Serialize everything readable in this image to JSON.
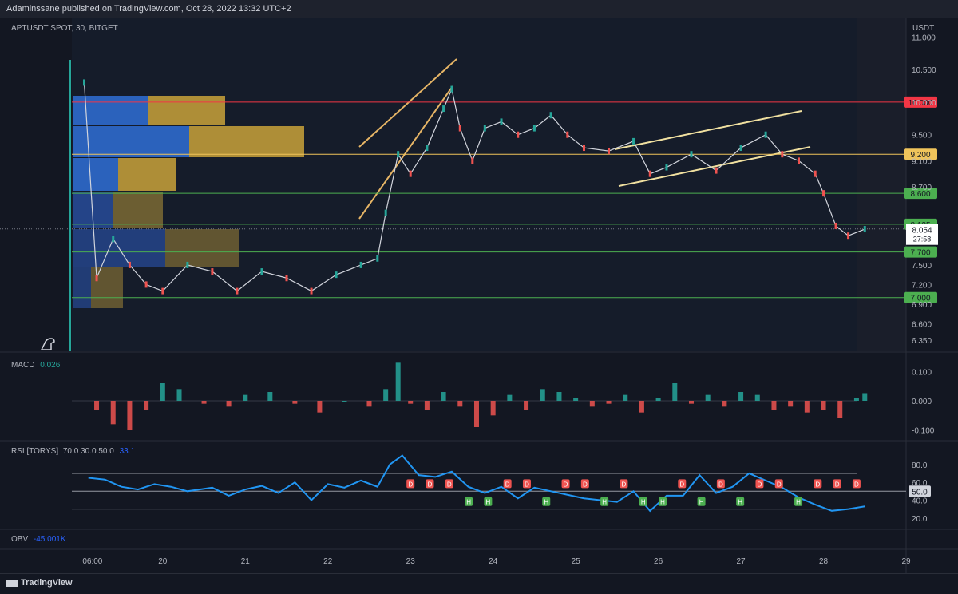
{
  "header": {
    "publisher_line": "Adaminssane published on TradingView.com, Oct 28, 2022 13:32 UTC+2"
  },
  "symbol": {
    "title": "APTUSDT SPOT, 30, BITGET",
    "currency": "USDT"
  },
  "footer": {
    "brand": "TradingView"
  },
  "colors": {
    "up": "#26a69a",
    "down": "#ef5350",
    "rsi": "#2196f3",
    "resistance": "#f23645",
    "pivot": "#f0c45b",
    "support": "#4caf50"
  },
  "chart_data": [
    {
      "type": "line",
      "title": "APTUSDT SPOT, 30, BITGET",
      "ylabel": "USDT",
      "ylim": [
        6.2,
        11.2
      ],
      "y_ticks": [
        "11.000",
        "10.500",
        "10.000",
        "9.500",
        "9.200",
        "9.100",
        "8.700",
        "8.600",
        "8.125",
        "8.054",
        "7.700",
        "7.500",
        "7.200",
        "7.000",
        "6.900",
        "6.600",
        "6.350"
      ],
      "x_ticks": [
        "06:00",
        "20",
        "21",
        "22",
        "23",
        "24",
        "25",
        "26",
        "27",
        "28",
        "29"
      ],
      "x": [
        19.05,
        19.2,
        19.4,
        19.6,
        19.8,
        20.0,
        20.3,
        20.6,
        20.9,
        21.2,
        21.5,
        21.8,
        22.1,
        22.4,
        22.6,
        22.7,
        22.85,
        23.0,
        23.2,
        23.4,
        23.5,
        23.6,
        23.75,
        23.9,
        24.1,
        24.3,
        24.5,
        24.7,
        24.9,
        25.1,
        25.4,
        25.7,
        25.9,
        26.1,
        26.4,
        26.7,
        27.0,
        27.3,
        27.5,
        27.7,
        27.9,
        28.0,
        28.15,
        28.3,
        28.5
      ],
      "series": [
        {
          "values": [
            10.3,
            7.3,
            7.9,
            7.5,
            7.2,
            7.1,
            7.5,
            7.4,
            7.1,
            7.4,
            7.3,
            7.1,
            7.35,
            7.5,
            7.6,
            8.3,
            9.2,
            8.9,
            9.3,
            9.9,
            10.2,
            9.6,
            9.1,
            9.6,
            9.7,
            9.5,
            9.6,
            9.8,
            9.5,
            9.3,
            9.25,
            9.4,
            8.9,
            9.0,
            9.2,
            8.95,
            9.3,
            9.5,
            9.2,
            9.1,
            8.9,
            8.6,
            8.1,
            7.95,
            8.05
          ]
        }
      ],
      "horizontal_levels": [
        {
          "value": 10.0,
          "label": "10.000"
        },
        {
          "value": 9.2,
          "label": "9.200"
        },
        {
          "value": 8.6,
          "label": "8.600"
        },
        {
          "value": 8.125,
          "label": "8.125"
        },
        {
          "value": 7.7,
          "label": "7.700"
        },
        {
          "value": 7.0,
          "label": "7.000"
        }
      ],
      "last_price": {
        "value": "8.054",
        "countdown": "27:58"
      }
    },
    {
      "type": "bar",
      "title": "MACD",
      "current_value": "0.026",
      "ylim": [
        -0.12,
        0.12
      ],
      "y_ticks": [
        "0.100",
        "0.000",
        "-0.100"
      ],
      "x": [
        19.2,
        19.4,
        19.6,
        19.8,
        20.0,
        20.2,
        20.5,
        20.8,
        21.0,
        21.3,
        21.6,
        21.9,
        22.2,
        22.5,
        22.7,
        22.85,
        23.0,
        23.2,
        23.4,
        23.6,
        23.8,
        24.0,
        24.2,
        24.4,
        24.6,
        24.8,
        25.0,
        25.2,
        25.4,
        25.6,
        25.8,
        26.0,
        26.2,
        26.4,
        26.6,
        26.8,
        27.0,
        27.2,
        27.4,
        27.6,
        27.8,
        28.0,
        28.2,
        28.4,
        28.5
      ],
      "values": [
        -0.03,
        -0.08,
        -0.1,
        -0.03,
        0.06,
        0.04,
        -0.01,
        -0.02,
        0.02,
        0.03,
        -0.01,
        -0.04,
        0.0,
        -0.02,
        0.04,
        0.13,
        -0.01,
        -0.03,
        0.03,
        -0.02,
        -0.09,
        -0.05,
        0.02,
        -0.03,
        0.04,
        0.03,
        0.01,
        -0.02,
        -0.01,
        0.02,
        -0.04,
        0.01,
        0.06,
        -0.01,
        0.02,
        -0.02,
        0.03,
        0.02,
        -0.03,
        -0.02,
        -0.04,
        -0.03,
        -0.06,
        0.01,
        0.026
      ]
    },
    {
      "type": "line",
      "title": "RSI [TORYS]",
      "params": "70.0  30.0  50.0",
      "current_value": "33.1",
      "ylim": [
        10,
        95
      ],
      "y_ticks": [
        "80.0",
        "60.0",
        "50.0",
        "40.0",
        "20.0"
      ],
      "bands": [
        70,
        50,
        30
      ],
      "x": [
        19.1,
        19.3,
        19.5,
        19.7,
        19.9,
        20.1,
        20.3,
        20.6,
        20.8,
        21.0,
        21.2,
        21.4,
        21.6,
        21.8,
        22.0,
        22.2,
        22.4,
        22.6,
        22.75,
        22.9,
        23.1,
        23.3,
        23.5,
        23.7,
        23.9,
        24.1,
        24.3,
        24.5,
        24.7,
        24.9,
        25.1,
        25.3,
        25.5,
        25.7,
        25.9,
        26.1,
        26.3,
        26.5,
        26.7,
        26.9,
        27.1,
        27.3,
        27.5,
        27.7,
        27.9,
        28.1,
        28.3,
        28.5
      ],
      "series": [
        {
          "name": "RSI",
          "values": [
            65,
            63,
            55,
            52,
            58,
            55,
            50,
            54,
            45,
            52,
            56,
            48,
            60,
            40,
            58,
            54,
            62,
            55,
            80,
            90,
            68,
            66,
            72,
            55,
            48,
            55,
            42,
            54,
            50,
            46,
            42,
            40,
            38,
            50,
            28,
            45,
            45,
            68,
            48,
            55,
            70,
            62,
            54,
            43,
            35,
            28,
            30,
            33
          ]
        }
      ],
      "markers": [
        "D",
        "D",
        "D",
        "H",
        "H",
        "D",
        "D",
        "H",
        "D",
        "D",
        "H",
        "D",
        "H",
        "H",
        "D",
        "H",
        "D",
        "H",
        "D",
        "D",
        "H",
        "D",
        "D",
        "D"
      ]
    },
    {
      "type": "line",
      "title": "OBV",
      "current_value": "-45.001K"
    }
  ]
}
